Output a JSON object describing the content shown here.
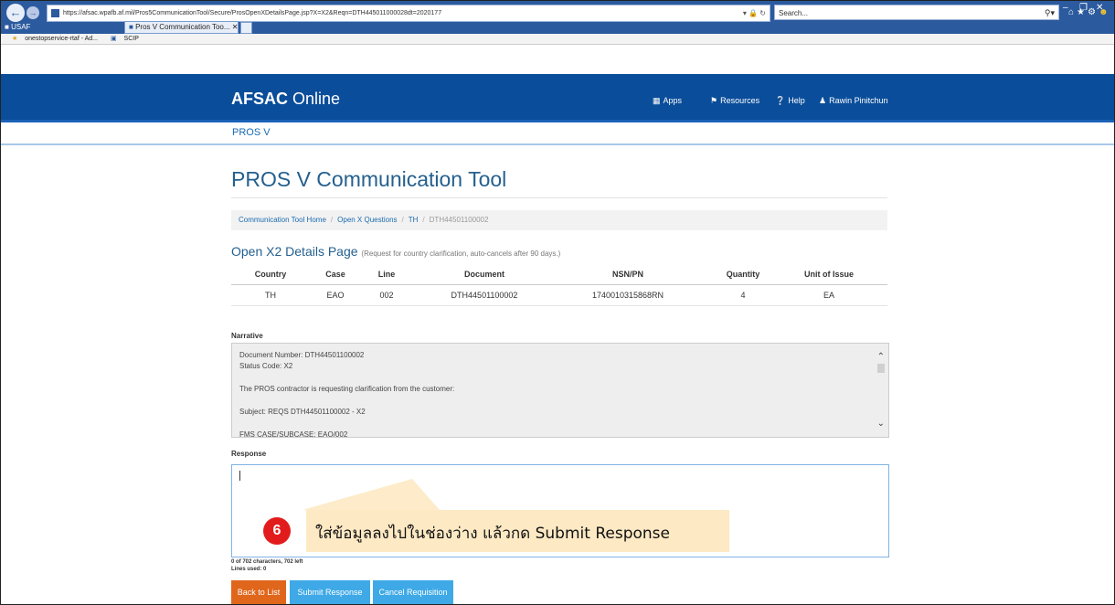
{
  "browser": {
    "url": "https://afsac.wpafb.af.mil/Pros5CommunicationTool/Secure/ProsOpenXDetailsPage.jsp?X=X2&Reqn=DTH445011000028dt=2020177",
    "search_placeholder": "Search...",
    "tabs": [
      {
        "label": "USAF"
      },
      {
        "label": "Pros V Communication Too..."
      }
    ],
    "favorites": [
      "onestopservice-rtaf - Ad...",
      "SCIP"
    ]
  },
  "header": {
    "brand_bold": "AFSAC",
    "brand_rest": " Online",
    "nav": [
      {
        "label": "Apps",
        "icon": "grid-icon"
      },
      {
        "label": "Resources",
        "icon": "bookmark-icon"
      },
      {
        "label": "Help",
        "icon": "help-icon"
      },
      {
        "label": "Rawin Pinitchun",
        "icon": "user-icon"
      }
    ],
    "subnav": "PROS V"
  },
  "page": {
    "title": "PROS V Communication Tool",
    "breadcrumb": [
      "Communication Tool Home",
      "Open X Questions",
      "TH",
      "DTH44501100002"
    ],
    "section_title": "Open X2 Details Page",
    "section_note": "(Request for country clarification, auto-cancels after 90 days.)"
  },
  "table": {
    "columns": [
      "Country",
      "Case",
      "Line",
      "Document",
      "NSN/PN",
      "Quantity",
      "Unit of Issue"
    ],
    "rows": [
      [
        "TH",
        "EAO",
        "002",
        "DTH44501100002",
        "1740010315868RN",
        "4",
        "EA"
      ]
    ]
  },
  "narrative": {
    "label": "Narrative",
    "lines": [
      "Document Number: DTH44501100002",
      "Status Code: X2",
      "The PROS contractor is requesting clarification from the customer:",
      "Subject: REQS DTH44501100002 - X2",
      "FMS CASE/SUBCASE: EAO/002"
    ]
  },
  "response": {
    "label": "Response",
    "value": "",
    "counter": "0 of 702 characters, 702 left",
    "lines_used": "Lines used: 0"
  },
  "callout": {
    "step": "6",
    "text": "ใส่ข้อมูลลงไปในช่องว่าง แล้วกด Submit Response"
  },
  "buttons": {
    "back": "Back to List",
    "submit": "Submit Response",
    "cancel": "Cancel Requisition"
  },
  "colors": {
    "header_blue": "#0a4d9a",
    "title_blue": "#25608f",
    "link_blue": "#1a6bb0",
    "back_orange": "#e0661c",
    "button_blue": "#3ea9e6",
    "callout_bg": "#fde9c4",
    "step_red": "#e21c1c"
  }
}
